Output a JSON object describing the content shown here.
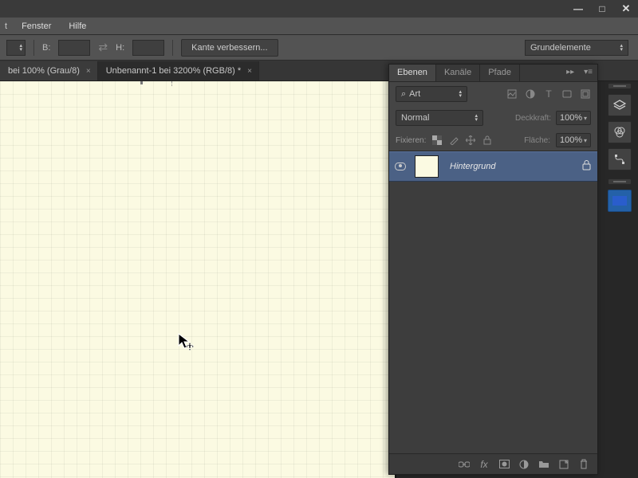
{
  "menubar": {
    "trunc": "t",
    "fenster": "Fenster",
    "hilfe": "Hilfe"
  },
  "win_buttons": {
    "min": "—",
    "max": "□",
    "close": "✕"
  },
  "optionsbar": {
    "b_label": "B:",
    "h_label": "H:",
    "swap": "⇄",
    "refine_btn": "Kante verbessern...",
    "preset": "Grundelemente"
  },
  "tabs": [
    {
      "title": "bei 100% (Grau/8)",
      "active": false
    },
    {
      "title": "Unbenannt-1 bei 3200% (RGB/8) *",
      "active": true
    }
  ],
  "panel": {
    "tab_ebenen": "Ebenen",
    "tab_kanale": "Kanäle",
    "tab_pfade": "Pfade",
    "filter_icon": "⌕",
    "filter_label": "Art",
    "blend": "Normal",
    "deckkraft_label": "Deckkraft:",
    "deckkraft_val": "100%",
    "fixieren_label": "Fixieren:",
    "flache_label": "Fläche:",
    "flache_val": "100%",
    "layer_name": "Hintergrund"
  }
}
